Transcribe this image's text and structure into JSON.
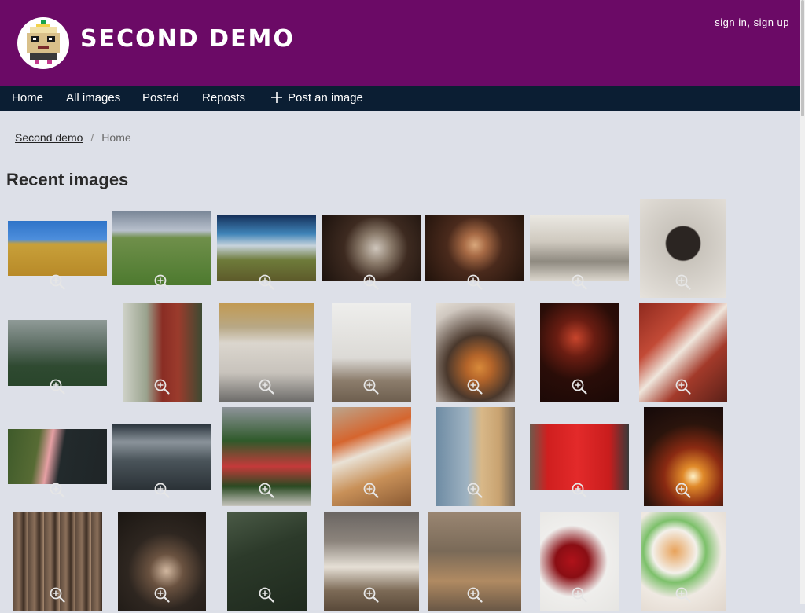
{
  "site": {
    "title": "SECOND DEMO",
    "user_links": {
      "sign_in": "sign in",
      "separator": ", ",
      "sign_up": "sign up"
    }
  },
  "nav": {
    "home": "Home",
    "all_images": "All images",
    "posted": "Posted",
    "reposts": "Reposts",
    "post_image": "Post an image"
  },
  "breadcrumb": {
    "root": "Second demo",
    "separator": "/",
    "current": "Home"
  },
  "section_title": "Recent images",
  "colors": {
    "header_bg": "#6b0a66",
    "nav_bg": "#0b1e33",
    "page_bg": "#dde0e8",
    "zoom_icon": "#e6e6e6"
  },
  "gallery": {
    "rows": [
      [
        {
          "name": "wheat-field",
          "bg": "linear-gradient(180deg,#2f74c8 0%,#4d8edc 34%,#c8a03a 42%,#b88a28 100%)"
        },
        {
          "name": "green-meadow",
          "bg": "linear-gradient(180deg,#7b8899 0%,#b8c0cc 26%,#6f8f4a 36%,#4d7a2f 100%)"
        },
        {
          "name": "stormy-plain",
          "bg": "linear-gradient(180deg,#15305a 0%,#3f84b8 28%,#c7d3dc 46%,#6e7b3a 68%,#5d5a2a 100%)"
        },
        {
          "name": "white-dog",
          "bg": "radial-gradient(circle at 55% 50%,#cfc6bc 0%,#8a7a6a 24%,#3d2a20 50%,#1c120d 100%)"
        },
        {
          "name": "archway-hall",
          "bg": "radial-gradient(circle at 50% 45%,#d9a77b 0%,#a76a45 18%,#4a2a1c 45%,#20120b 100%)"
        },
        {
          "name": "oculus-station",
          "bg": "linear-gradient(180deg,#eae8e2 0%,#cfc9bf 40%,#8f8a80 70%,#ddd8cf 100%)"
        },
        {
          "name": "window-horse",
          "bg": "radial-gradient(circle at 50% 45%,#2b2522 0%,#2b2522 24%,#c9c4bc 26%,#e6e2dc 100%)"
        }
      ],
      [
        {
          "name": "forest-fog",
          "bg": "linear-gradient(180deg,#909b98 0%,#5c6d63 40%,#2f4a31 70%,#29452b 100%)"
        },
        {
          "name": "woman-red-coat",
          "bg": "linear-gradient(90deg,#cfd2c8 0%,#9aa38e 30%,#8a2d24 50%,#9b3b2c 70%,#3d4a32 100%)"
        },
        {
          "name": "cyclists-wall",
          "bg": "linear-gradient(180deg,#c29a52 0%,#b8a886 24%,#dbd6ce 40%,#c8c3bc 70%,#6b6a68 100%)"
        },
        {
          "name": "bare-sapling",
          "bg": "linear-gradient(180deg,#eeeeec 0%,#dcdad6 55%,#8c7d6c 78%,#6d5e4e 100%)"
        },
        {
          "name": "pumpkins-candles",
          "bg": "radial-gradient(circle at 55% 65%,#d88a3a 0%,#b5652a 16%,#4a382c 42%,#cfc7bf 80%,#e5e0d8 100%)"
        },
        {
          "name": "green-hair-portrait",
          "bg": "radial-gradient(circle at 45% 35%,#c8452c 0%,#6a1d12 24%,#2a0d08 54%,#1a0806 100%)"
        },
        {
          "name": "red-rooftops",
          "bg": "linear-gradient(135deg,#8f2a1f 0%,#c24a36 30%,#efe6dc 48%,#a33a2a 68%,#5a2018 100%)"
        }
      ],
      [
        {
          "name": "coastline-aerial",
          "bg": "linear-gradient(100deg,#3e5a2a 0%,#576b34 30%,#e6a0a4 42%,#222a2c 54%,#1f2527 100%)"
        },
        {
          "name": "mountain-clouds",
          "bg": "linear-gradient(180deg,#27313a 0%,#8a939a 28%,#4a545a 56%,#2b3237 100%)"
        },
        {
          "name": "flower-bench",
          "bg": "linear-gradient(180deg,#8e949a 0%,#2f5a2a 34%,#c43a3a 60%,#2a4a22 80%,#c8c6c0 100%)"
        },
        {
          "name": "cafe-table",
          "bg": "linear-gradient(160deg,#bba68e 0%,#d5652e 30%,#e9e2d6 46%,#c89058 70%,#8a5a33 100%)"
        },
        {
          "name": "castle-tower",
          "bg": "linear-gradient(90deg,#6d8ba3 0%,#9fb3c2 40%,#d8b888 58%,#c9a371 80%,#7a6a58 100%)"
        },
        {
          "name": "phone-booth",
          "bg": "linear-gradient(90deg,#6e5a4c 0%,#d01f1f 18%,#e32a2a 48%,#c91d1d 80%,#3a3a3a 100%)"
        },
        {
          "name": "candle-leaves",
          "bg": "radial-gradient(circle at 62% 70%,#fff2c8 0%,#e08a2a 12%,#8a2a12 34%,#2a140c 62%,#14090a 100%)"
        }
      ],
      [
        {
          "name": "tall-trunks",
          "bg": "repeating-linear-gradient(90deg,#5d4a3c 0px,#8a6f5a 8px,#3d2e24 14px,#a88a70 20px)"
        },
        {
          "name": "woman-cafe",
          "bg": "radial-gradient(circle at 55% 60%,#d2b8a0 0%,#6a5240 22%,#2e2620 50%,#1a1612 100%)"
        },
        {
          "name": "dark-grass",
          "bg": "linear-gradient(160deg,#4a5a46 0%,#2c3a2a 40%,#1f2a1e 100%)"
        },
        {
          "name": "book-wood",
          "bg": "linear-gradient(180deg,#6a6562 0%,#8c847c 30%,#e6e0d6 56%,#7c6a56 80%,#5a4a3a 100%)"
        },
        {
          "name": "deer-forest",
          "bg": "linear-gradient(180deg,#9a8672 0%,#7a6a58 40%,#b08a62 70%,#6a5846 100%)"
        },
        {
          "name": "red-dahlias",
          "bg": "radial-gradient(circle at 40% 50%,#b0121a 0%,#8a0e14 24%,#efeeec 52%,#e6e5e2 100%)"
        },
        {
          "name": "glassware",
          "bg": "radial-gradient(circle at 40% 40%,#e8a25a 0%,#f3f0ea 28%,#7cc06a 40%,#efe9e2 60%,#e0d6cc 100%)"
        }
      ]
    ]
  }
}
